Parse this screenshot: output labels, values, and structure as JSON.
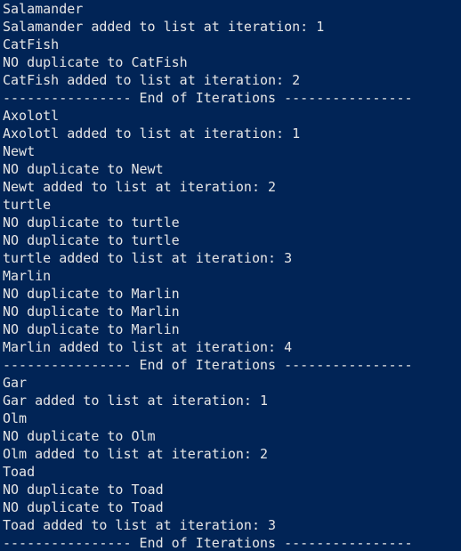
{
  "terminal": {
    "lines": [
      "Salamander",
      "Salamander added to list at iteration: 1",
      "CatFish",
      "NO duplicate to CatFish",
      "CatFish added to list at iteration: 2",
      "---------------- End of Iterations ----------------",
      "Axolotl",
      "Axolotl added to list at iteration: 1",
      "Newt",
      "NO duplicate to Newt",
      "Newt added to list at iteration: 2",
      "turtle",
      "NO duplicate to turtle",
      "NO duplicate to turtle",
      "turtle added to list at iteration: 3",
      "Marlin",
      "NO duplicate to Marlin",
      "NO duplicate to Marlin",
      "NO duplicate to Marlin",
      "Marlin added to list at iteration: 4",
      "---------------- End of Iterations ----------------",
      "Gar",
      "Gar added to list at iteration: 1",
      "Olm",
      "NO duplicate to Olm",
      "Olm added to list at iteration: 2",
      "Toad",
      "NO duplicate to Toad",
      "NO duplicate to Toad",
      "Toad added to list at iteration: 3",
      "---------------- End of Iterations ----------------"
    ]
  },
  "colors": {
    "background": "#012456",
    "text": "#e6e6e6"
  }
}
